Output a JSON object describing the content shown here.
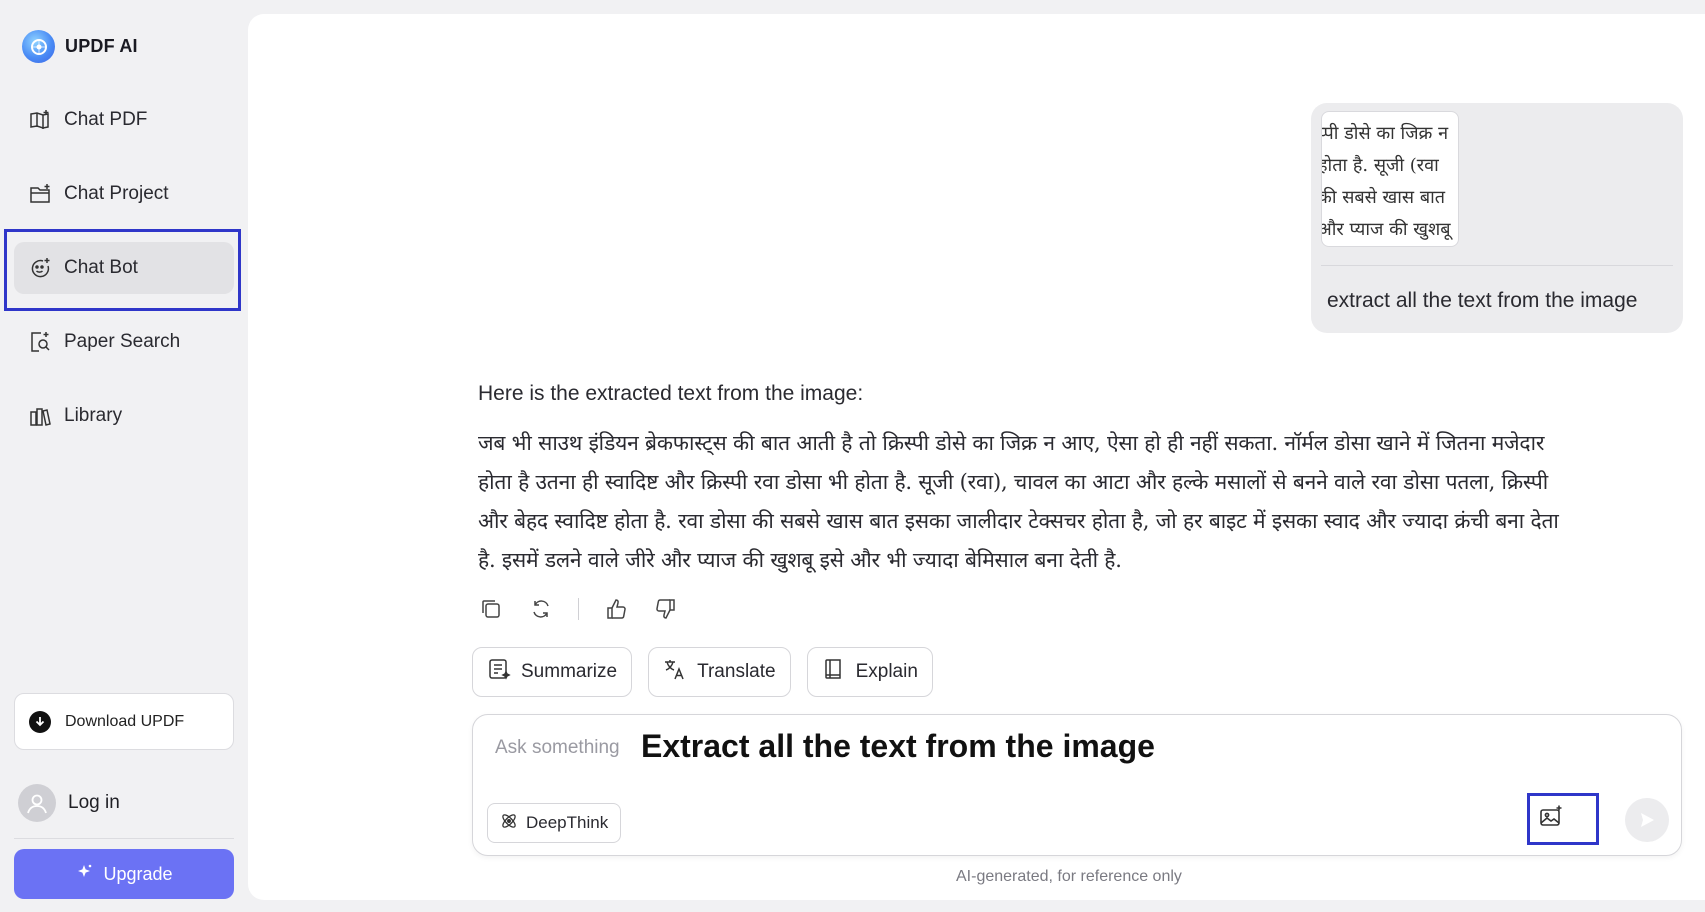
{
  "brand": {
    "name": "UPDF AI",
    "logo_icon": "updf-ai-logo-icon"
  },
  "sidebar": {
    "items": [
      {
        "label": "Chat PDF",
        "icon": "book-plus-icon",
        "active": false
      },
      {
        "label": "Chat Project",
        "icon": "folder-plus-icon",
        "active": false
      },
      {
        "label": "Chat Bot",
        "icon": "bot-face-icon",
        "active": true
      },
      {
        "label": "Paper Search",
        "icon": "paper-search-icon",
        "active": false
      },
      {
        "label": "Library",
        "icon": "library-icon",
        "active": false
      }
    ],
    "download_label": "Download UPDF",
    "login_label": "Log in",
    "upgrade_label": "Upgrade"
  },
  "conversation": {
    "user_message": {
      "image_lines": [
        "प्पी डोसे का जिक्र न",
        "होता है. सूजी (रवा",
        "की सबसे खास बात",
        "और प्याज की खुशबू"
      ],
      "text": "extract all the text from the image"
    },
    "assistant_message": {
      "intro": "Here is the extracted text from the image:",
      "body_lines": [
        "जब भी साउथ इंडियन ब्रेकफास्ट्स की बात आती है तो क्रिस्पी डोसे का जिक्र न आए, ऐसा हो ही नहीं सकता. नॉर्मल डोसा खाने में जितना मजेदार",
        "होता है उतना ही स्वादिष्ट और क्रिस्पी रवा डोसा भी होता है. सूजी (रवा), चावल का आटा और हल्के मसालों से बनने वाले रवा डोसा पतला, क्रिस्पी",
        "और बेहद स्वादिष्ट होता है. रवा डोसा की सबसे खास बात इसका जालीदार टेक्सचर होता है, जो हर बाइट में इसका स्वाद और ज्यादा क्रंची बना देता",
        "है. इसमें डलने वाले जीरे और प्याज की खुशबू इसे और भी ज्यादा बेमिसाल बना देती है."
      ]
    }
  },
  "quick_actions": [
    {
      "label": "Summarize",
      "icon": "summarize-icon"
    },
    {
      "label": "Translate",
      "icon": "translate-icon"
    },
    {
      "label": "Explain",
      "icon": "explain-book-icon"
    }
  ],
  "composer": {
    "placeholder": "Ask something",
    "overlay_caption": "Extract all the text from the image",
    "deepthink_label": "DeepThink"
  },
  "disclaimer": "AI-generated, for reference only",
  "colors": {
    "accent": "#6b72f4",
    "highlight": "#2f36c9",
    "active_bg": "#e2e2e5"
  }
}
